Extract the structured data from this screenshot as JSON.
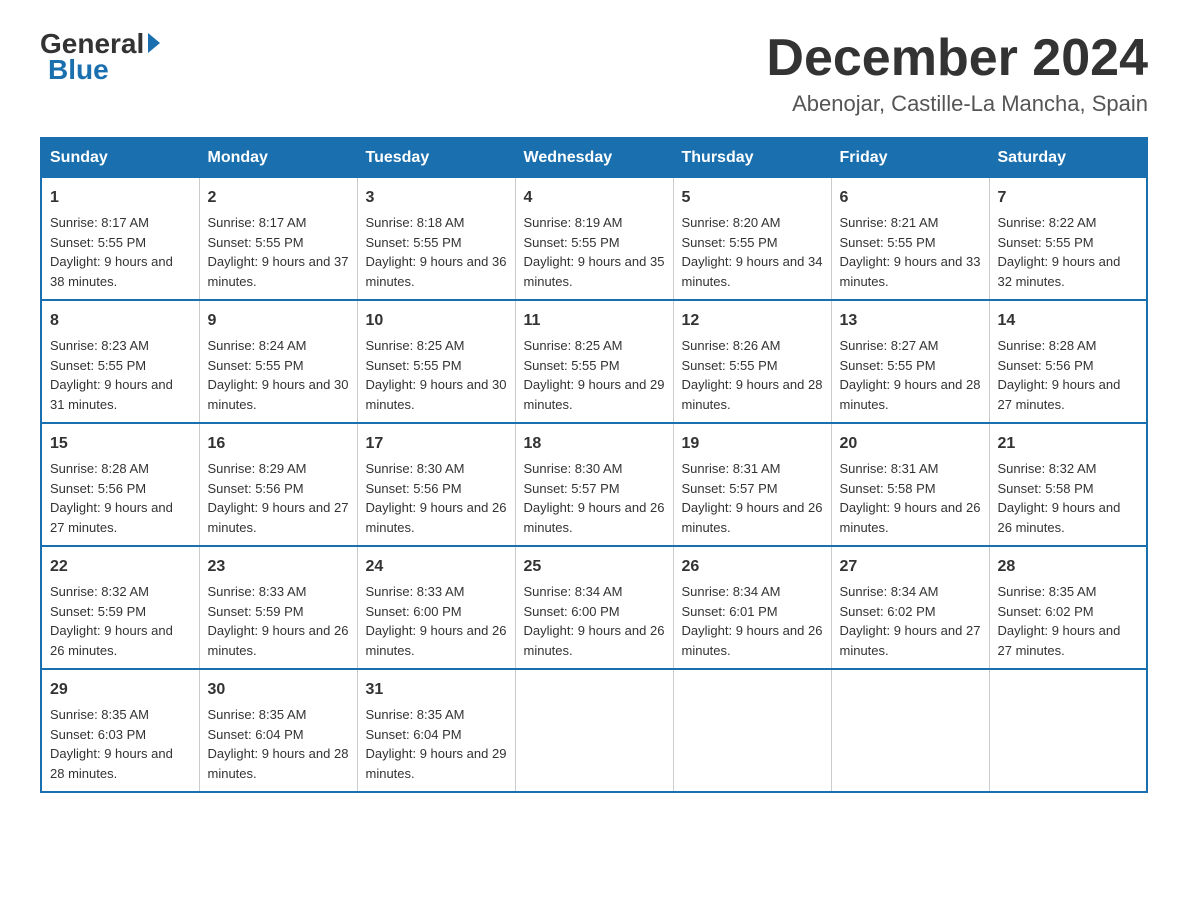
{
  "logo": {
    "general": "General",
    "blue": "Blue"
  },
  "title": "December 2024",
  "subtitle": "Abenojar, Castille-La Mancha, Spain",
  "days_of_week": [
    "Sunday",
    "Monday",
    "Tuesday",
    "Wednesday",
    "Thursday",
    "Friday",
    "Saturday"
  ],
  "weeks": [
    [
      {
        "day": "1",
        "sunrise": "8:17 AM",
        "sunset": "5:55 PM",
        "daylight": "9 hours and 38 minutes."
      },
      {
        "day": "2",
        "sunrise": "8:17 AM",
        "sunset": "5:55 PM",
        "daylight": "9 hours and 37 minutes."
      },
      {
        "day": "3",
        "sunrise": "8:18 AM",
        "sunset": "5:55 PM",
        "daylight": "9 hours and 36 minutes."
      },
      {
        "day": "4",
        "sunrise": "8:19 AM",
        "sunset": "5:55 PM",
        "daylight": "9 hours and 35 minutes."
      },
      {
        "day": "5",
        "sunrise": "8:20 AM",
        "sunset": "5:55 PM",
        "daylight": "9 hours and 34 minutes."
      },
      {
        "day": "6",
        "sunrise": "8:21 AM",
        "sunset": "5:55 PM",
        "daylight": "9 hours and 33 minutes."
      },
      {
        "day": "7",
        "sunrise": "8:22 AM",
        "sunset": "5:55 PM",
        "daylight": "9 hours and 32 minutes."
      }
    ],
    [
      {
        "day": "8",
        "sunrise": "8:23 AM",
        "sunset": "5:55 PM",
        "daylight": "9 hours and 31 minutes."
      },
      {
        "day": "9",
        "sunrise": "8:24 AM",
        "sunset": "5:55 PM",
        "daylight": "9 hours and 30 minutes."
      },
      {
        "day": "10",
        "sunrise": "8:25 AM",
        "sunset": "5:55 PM",
        "daylight": "9 hours and 30 minutes."
      },
      {
        "day": "11",
        "sunrise": "8:25 AM",
        "sunset": "5:55 PM",
        "daylight": "9 hours and 29 minutes."
      },
      {
        "day": "12",
        "sunrise": "8:26 AM",
        "sunset": "5:55 PM",
        "daylight": "9 hours and 28 minutes."
      },
      {
        "day": "13",
        "sunrise": "8:27 AM",
        "sunset": "5:55 PM",
        "daylight": "9 hours and 28 minutes."
      },
      {
        "day": "14",
        "sunrise": "8:28 AM",
        "sunset": "5:56 PM",
        "daylight": "9 hours and 27 minutes."
      }
    ],
    [
      {
        "day": "15",
        "sunrise": "8:28 AM",
        "sunset": "5:56 PM",
        "daylight": "9 hours and 27 minutes."
      },
      {
        "day": "16",
        "sunrise": "8:29 AM",
        "sunset": "5:56 PM",
        "daylight": "9 hours and 27 minutes."
      },
      {
        "day": "17",
        "sunrise": "8:30 AM",
        "sunset": "5:56 PM",
        "daylight": "9 hours and 26 minutes."
      },
      {
        "day": "18",
        "sunrise": "8:30 AM",
        "sunset": "5:57 PM",
        "daylight": "9 hours and 26 minutes."
      },
      {
        "day": "19",
        "sunrise": "8:31 AM",
        "sunset": "5:57 PM",
        "daylight": "9 hours and 26 minutes."
      },
      {
        "day": "20",
        "sunrise": "8:31 AM",
        "sunset": "5:58 PM",
        "daylight": "9 hours and 26 minutes."
      },
      {
        "day": "21",
        "sunrise": "8:32 AM",
        "sunset": "5:58 PM",
        "daylight": "9 hours and 26 minutes."
      }
    ],
    [
      {
        "day": "22",
        "sunrise": "8:32 AM",
        "sunset": "5:59 PM",
        "daylight": "9 hours and 26 minutes."
      },
      {
        "day": "23",
        "sunrise": "8:33 AM",
        "sunset": "5:59 PM",
        "daylight": "9 hours and 26 minutes."
      },
      {
        "day": "24",
        "sunrise": "8:33 AM",
        "sunset": "6:00 PM",
        "daylight": "9 hours and 26 minutes."
      },
      {
        "day": "25",
        "sunrise": "8:34 AM",
        "sunset": "6:00 PM",
        "daylight": "9 hours and 26 minutes."
      },
      {
        "day": "26",
        "sunrise": "8:34 AM",
        "sunset": "6:01 PM",
        "daylight": "9 hours and 26 minutes."
      },
      {
        "day": "27",
        "sunrise": "8:34 AM",
        "sunset": "6:02 PM",
        "daylight": "9 hours and 27 minutes."
      },
      {
        "day": "28",
        "sunrise": "8:35 AM",
        "sunset": "6:02 PM",
        "daylight": "9 hours and 27 minutes."
      }
    ],
    [
      {
        "day": "29",
        "sunrise": "8:35 AM",
        "sunset": "6:03 PM",
        "daylight": "9 hours and 28 minutes."
      },
      {
        "day": "30",
        "sunrise": "8:35 AM",
        "sunset": "6:04 PM",
        "daylight": "9 hours and 28 minutes."
      },
      {
        "day": "31",
        "sunrise": "8:35 AM",
        "sunset": "6:04 PM",
        "daylight": "9 hours and 29 minutes."
      },
      null,
      null,
      null,
      null
    ]
  ]
}
